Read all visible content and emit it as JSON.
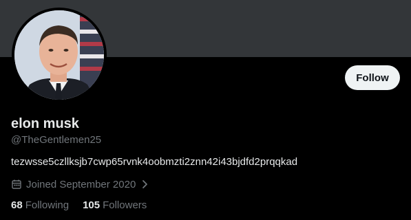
{
  "profile": {
    "display_name": "elon musk",
    "handle": "@TheGentlemen25",
    "bio": "tezwsse5czllksjb7cwp65rvnk4oobmzti2znn42i43bjdfd2prqqkad",
    "joined": "Joined September 2020",
    "avatar_alt": "profile photo"
  },
  "actions": {
    "follow_label": "Follow"
  },
  "stats": {
    "following_count": "68",
    "following_label": "Following",
    "followers_count": "105",
    "followers_label": "Followers"
  },
  "colors": {
    "background": "#000000",
    "banner": "#333639",
    "primary_text": "#e7e9ea",
    "secondary_text": "#71767b",
    "follow_button_bg": "#eff3f4"
  },
  "icons": {
    "joined": "calendar-icon",
    "more": "chevron-right-icon"
  }
}
